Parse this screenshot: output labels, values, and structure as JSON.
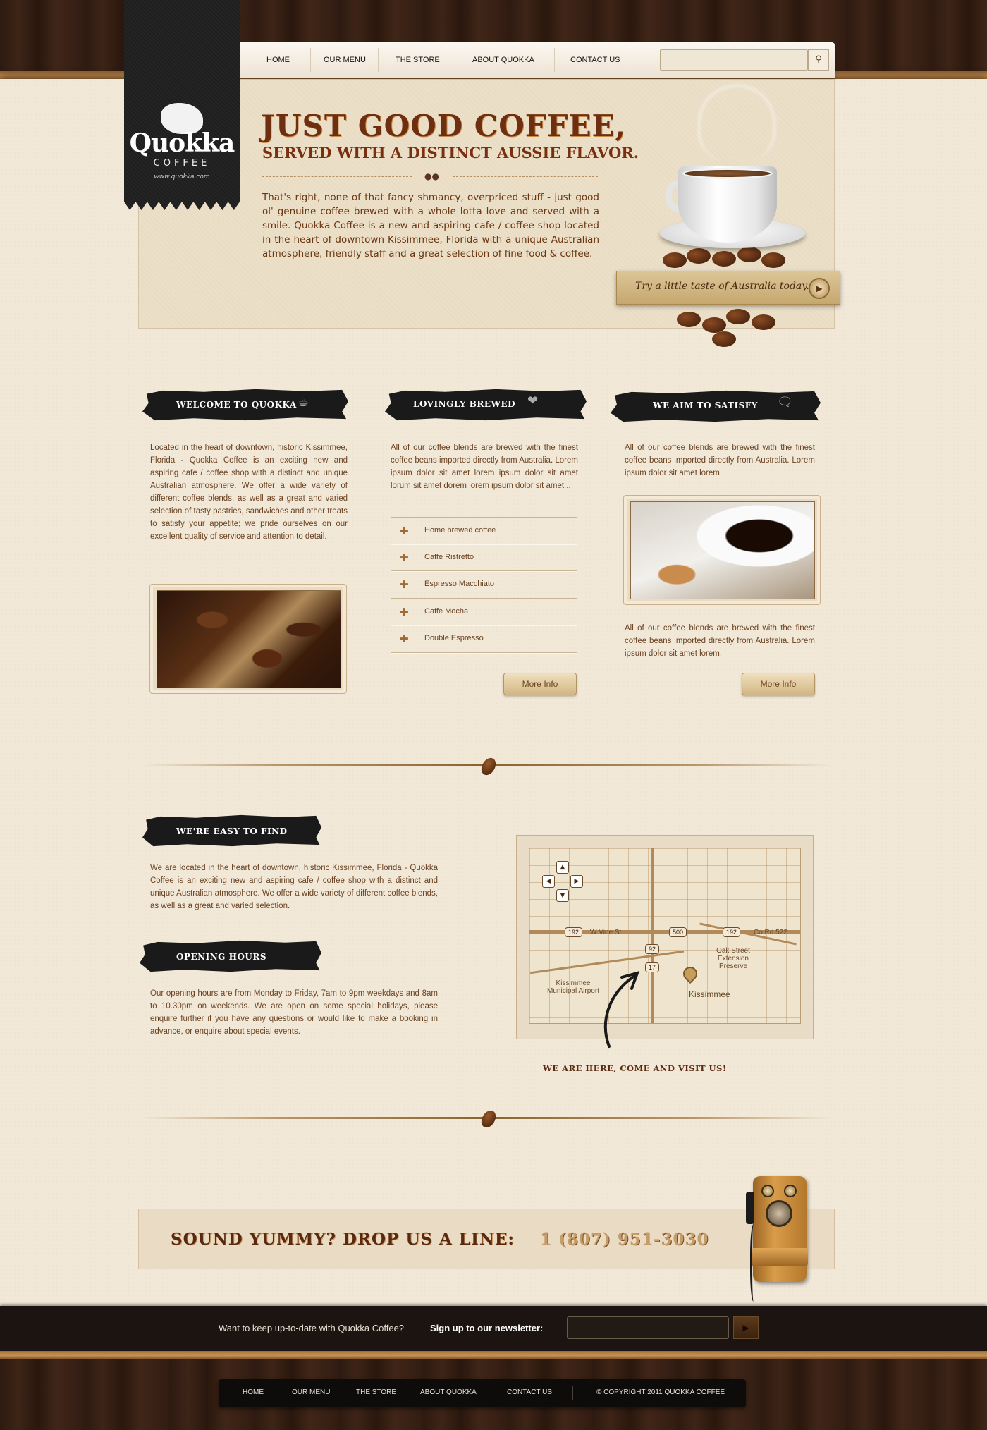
{
  "brand": {
    "name": "Quokka",
    "sub": "COFFEE",
    "url": "www.quokka.com"
  },
  "nav": {
    "items": [
      "HOME",
      "OUR MENU",
      "THE STORE",
      "ABOUT QUOKKA",
      "CONTACT US"
    ],
    "search_placeholder": "",
    "search_icon": "search-icon"
  },
  "hero": {
    "title": "JUST GOOD COFFEE,",
    "subtitle": "SERVED WITH A DISTINCT AUSSIE FLAVOR.",
    "text": "That's right, none of that fancy shmancy, overpriced stuff - just good ol' genuine coffee brewed with a whole lotta love and served with a smile. Quokka Coffee is a new and aspiring cafe / coffee shop located in the heart of downtown Kissimmee, Florida with a unique Australian atmosphere, friendly staff and a great selection of fine food & coffee.",
    "banner": "Try a little taste of Australia today..."
  },
  "columns": {
    "welcome": {
      "title": "WELCOME TO QUOKKA",
      "text": "Located in the heart of downtown, historic Kissimmee, Florida - Quokka Coffee is an exciting new and aspiring cafe / coffee shop with a distinct and unique Australian atmosphere. We offer a wide variety of different coffee blends, as well as a great and varied selection of tasty pastries, sandwiches and other treats to satisfy your appetite; we pride ourselves on our excellent quality of service and attention to detail."
    },
    "brewed": {
      "title": "LOVINGLY BREWED",
      "text": "All of our coffee blends are brewed with the finest coffee beans imported directly from Australia. Lorem ipsum dolor sit amet lorem ipsum dolor sit amet lorum sit amet dorem lorem ipsum dolor sit amet...",
      "items": [
        "Home brewed coffee",
        "Caffe Ristretto",
        "Espresso Macchiato",
        "Caffe Mocha",
        "Double Espresso"
      ],
      "button": "More Info"
    },
    "satisfy": {
      "title": "WE AIM TO SATISFY",
      "text1": "All of our coffee blends are brewed with the finest coffee beans imported directly from Australia. Lorem ipsum dolor sit amet lorem.",
      "text2": "All of our coffee blends are brewed with the finest coffee beans imported directly from Australia. Lorem ipsum dolor sit amet lorem.",
      "button": "More Info"
    }
  },
  "find": {
    "title": "WE'RE EASY TO FIND",
    "text": "We are located in the heart of downtown, historic Kissimmee, Florida - Quokka Coffee is an exciting new and aspiring cafe / coffee shop with a distinct and unique Australian atmosphere. We offer a wide variety of different coffee blends, as well as a great and varied selection."
  },
  "hours": {
    "title": "OPENING HOURS",
    "text": "Our opening hours are from Monday to Friday, 7am to 9pm weekdays and 8am to 10.30pm on weekends. We are open on some special holidays, please enquire further if you have any questions or would like to make a booking in advance, or enquire about special events."
  },
  "map": {
    "caption": "WE ARE HERE, COME AND VISIT US!",
    "labels": {
      "airport": "Kissimmee Municipal Airport",
      "city": "Kissimmee",
      "preserve": "Oak Street Extension Preserve",
      "street": "W Vine St",
      "street2": "Co Rd 522"
    },
    "shields": [
      "192",
      "500",
      "192",
      "92",
      "17"
    ]
  },
  "cta": {
    "text": "SOUND YUMMY? DROP US A LINE:",
    "phone": "1 (807) 951-3030"
  },
  "newsletter": {
    "text": "Want to keep up-to-date with Quokka Coffee?",
    "bold": "Sign up to our newsletter:"
  },
  "footer": {
    "items": [
      "HOME",
      "OUR MENU",
      "THE STORE",
      "ABOUT QUOKKA",
      "CONTACT US"
    ],
    "copyright": "© COPYRIGHT 2011 QUOKKA COFFEE"
  },
  "colors": {
    "accent": "#6e2e10",
    "text": "#6b4322",
    "dark": "#1b1410"
  }
}
